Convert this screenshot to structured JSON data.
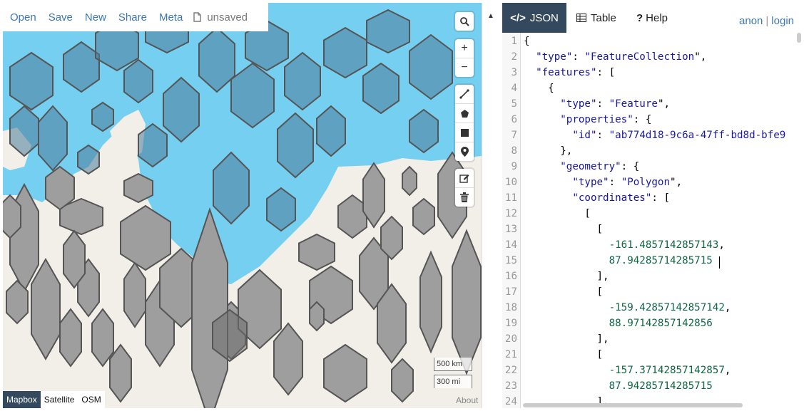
{
  "menu": {
    "items": [
      "Open",
      "Save",
      "New",
      "Share",
      "Meta"
    ],
    "status": "unsaved"
  },
  "map": {
    "zoom_in": "+",
    "zoom_out": "−",
    "scale_km": "500 km",
    "scale_mi": "300 mi",
    "layers": [
      {
        "label": "Mapbox",
        "active": true
      },
      {
        "label": "Satellite",
        "active": false
      },
      {
        "label": "OSM",
        "active": false
      }
    ],
    "about": "About",
    "colors": {
      "water": "#75cff0",
      "land": "#f2efe9",
      "hex_fill": "#9e9e9e",
      "hex_stroke": "#555555"
    }
  },
  "tabs": [
    {
      "label": "JSON",
      "active": true
    },
    {
      "label": "Table",
      "active": false
    },
    {
      "label": "Help",
      "active": false
    }
  ],
  "auth": {
    "anon": "anon",
    "sep": "|",
    "login": "login"
  },
  "editor": {
    "line_numbers": [
      "1",
      "2",
      "3",
      "4",
      "5",
      "6",
      "7",
      "8",
      "9",
      "10",
      "11",
      "12",
      "13",
      "14",
      "15",
      "16",
      "17",
      "18",
      "19",
      "20",
      "21",
      "22",
      "23",
      "24"
    ],
    "lines": [
      "{",
      "  \"type\": \"FeatureCollection\",",
      "  \"features\": [",
      "    {",
      "      \"type\": \"Feature\",",
      "      \"properties\": {",
      "        \"id\": \"ab774d18-9c6a-47ff-bd8d-bfe9",
      "      },",
      "      \"geometry\": {",
      "        \"type\": \"Polygon\",",
      "        \"coordinates\": [",
      "          [",
      "            [",
      "              -161.4857142857143,",
      "              87.94285714285715",
      "            ],",
      "            [",
      "              -159.42857142857142,",
      "              88.97142857142856",
      "            ],",
      "            [",
      "              -157.37142857142857,",
      "              87.94285714285715",
      "            ],"
    ]
  }
}
